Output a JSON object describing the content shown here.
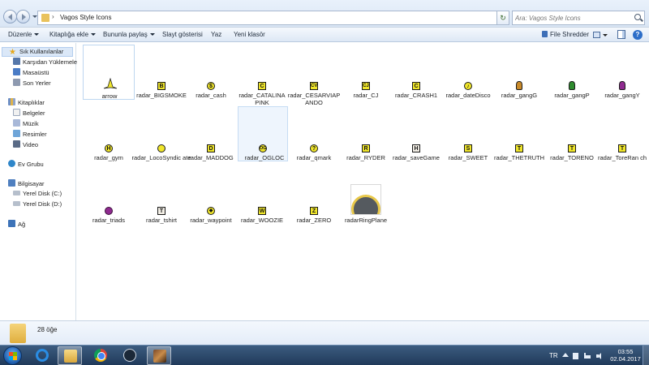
{
  "address": {
    "crumb": "Vagos Style Icons",
    "search_placeholder": "Ara: Vagos Style Icons",
    "refresh_glyph": "↻"
  },
  "commands": {
    "organize": "Düzenle",
    "include_library": "Kitaplığa ekle",
    "share_with": "Bununla paylaş",
    "slideshow": "Slayt gösterisi",
    "print": "Yaz",
    "new_folder": "Yeni klasör",
    "file_shredder": "File Shredder",
    "help_glyph": "?"
  },
  "sidebar": {
    "favorites": "Sık Kullanılanlar",
    "downloads": "Karşıdan Yüklemeler",
    "desktop": "Masaüstü",
    "recent": "Son Yerler",
    "libraries": "Kitaplıklar",
    "documents": "Belgeler",
    "music": "Müzik",
    "pictures": "Resimler",
    "videos": "Video",
    "homegroup": "Ev Grubu",
    "computer": "Bilgisayar",
    "drive_c": "Yerel Disk (C:)",
    "drive_d": "Yerel Disk (D:)",
    "network": "Ağ"
  },
  "files": [
    {
      "name": "arrow",
      "icon": "arrow-icon",
      "glyph": "",
      "color": "#f0e62a"
    },
    {
      "name": "radar_BIGSMOKE",
      "icon": "bigsmoke-icon",
      "glyph": "B",
      "color": "#f0e62a"
    },
    {
      "name": "radar_cash",
      "icon": "cash-icon",
      "glyph": "$",
      "color": "#f0e62a"
    },
    {
      "name": "radar_CATALINAPINK",
      "icon": "catalina-icon",
      "glyph": "C",
      "color": "#f0e62a"
    },
    {
      "name": "radar_CESARVIAPANDO",
      "icon": "cesar-icon",
      "glyph": "CV",
      "color": "#f0e62a"
    },
    {
      "name": "radar_CJ",
      "icon": "cj-icon",
      "glyph": "CJ",
      "color": "#f0e62a"
    },
    {
      "name": "radar_CRASH1",
      "icon": "crash-icon",
      "glyph": "C",
      "color": "#f0e62a"
    },
    {
      "name": "radar_dateDisco",
      "icon": "datedisco-icon",
      "glyph": "♪",
      "color": "#f0e62a"
    },
    {
      "name": "radar_gangG",
      "icon": "gang-green-icon",
      "glyph": "",
      "color": "#c98a2a"
    },
    {
      "name": "radar_gangP",
      "icon": "gang-purple-icon",
      "glyph": "",
      "color": "#2e8b2e"
    },
    {
      "name": "radar_gangY",
      "icon": "gang-yellow-icon",
      "glyph": "",
      "color": "#8f2a8f"
    },
    {
      "name": "radar_gym",
      "icon": "gym-icon",
      "glyph": "H",
      "color": "#f0e62a"
    },
    {
      "name": "radar_LocoSyndicate",
      "icon": "loco-icon",
      "glyph": "",
      "color": "#f0e62a"
    },
    {
      "name": "radar_MADDOG",
      "icon": "maddog-icon",
      "glyph": "D",
      "color": "#f0e62a"
    },
    {
      "name": "radar_OGLOC",
      "icon": "ogloc-icon",
      "glyph": "OG",
      "color": "#f0e62a"
    },
    {
      "name": "radar_qmark",
      "icon": "qmark-icon",
      "glyph": "?",
      "color": "#f0e62a"
    },
    {
      "name": "radar_RYDER",
      "icon": "ryder-icon",
      "glyph": "R",
      "color": "#f0e62a"
    },
    {
      "name": "radar_saveGame",
      "icon": "savegame-icon",
      "glyph": "H",
      "color": "#f3efe6"
    },
    {
      "name": "radar_SWEET",
      "icon": "sweet-icon",
      "glyph": "S",
      "color": "#f0e62a"
    },
    {
      "name": "radar_THETRUTH",
      "icon": "thetruth-icon",
      "glyph": "T",
      "color": "#f0e62a"
    },
    {
      "name": "radar_TORENO",
      "icon": "toreno-icon",
      "glyph": "T",
      "color": "#f0e62a"
    },
    {
      "name": "radar_ToreRanch",
      "icon": "toreno-ranch-icon",
      "glyph": "T",
      "color": "#f0e62a"
    },
    {
      "name": "radar_triads",
      "icon": "triads-icon",
      "glyph": "",
      "color": "#8f2a8f"
    },
    {
      "name": "radar_tshirt",
      "icon": "tshirt-icon",
      "glyph": "T",
      "color": "#f3efe6"
    },
    {
      "name": "radar_waypoint",
      "icon": "waypoint-icon",
      "glyph": "◆",
      "color": "#f0e62a"
    },
    {
      "name": "radar_WOOZIE",
      "icon": "woozie-icon",
      "glyph": "W",
      "color": "#f0e62a"
    },
    {
      "name": "radar_ZERO",
      "icon": "zero-icon",
      "glyph": "Z",
      "color": "#f0e62a"
    },
    {
      "name": "radarRingPlane",
      "icon": "ring-plane-icon",
      "glyph": "",
      "color": "#555a5f"
    }
  ],
  "file_labels": {
    "l0": "arrow",
    "l1": "radar_BIGSMOKE",
    "l2": "radar_cash",
    "l3": "radar_CATALINA PINK",
    "l4": "radar_CESARVIAP ANDO",
    "l5": "radar_CJ",
    "l6": "radar_CRASH1",
    "l7": "radar_dateDisco",
    "l8": "radar_gangG",
    "l9": "radar_gangP",
    "l10": "radar_gangY",
    "l11": "radar_gym",
    "l12": "radar_LocoSyndic ate",
    "l13": "radar_MADDOG",
    "l14": "radar_OGLOC",
    "l15": "radar_qmark",
    "l16": "radar_RYDER",
    "l17": "radar_saveGame",
    "l18": "radar_SWEET",
    "l19": "radar_THETRUTH",
    "l20": "radar_TORENO",
    "l21": "radar_ToreRan ch",
    "l22": "radar_triads",
    "l23": "radar_tshirt",
    "l24": "radar_waypoint",
    "l25": "radar_WOOZIE",
    "l26": "radar_ZERO",
    "l27": "radarRingPlane"
  },
  "details": {
    "item_count": "28 öğe"
  },
  "taskbar": {
    "language": "TR",
    "time": "03:55",
    "date": "02.04.2017",
    "active_app": "Windows Explorer"
  }
}
